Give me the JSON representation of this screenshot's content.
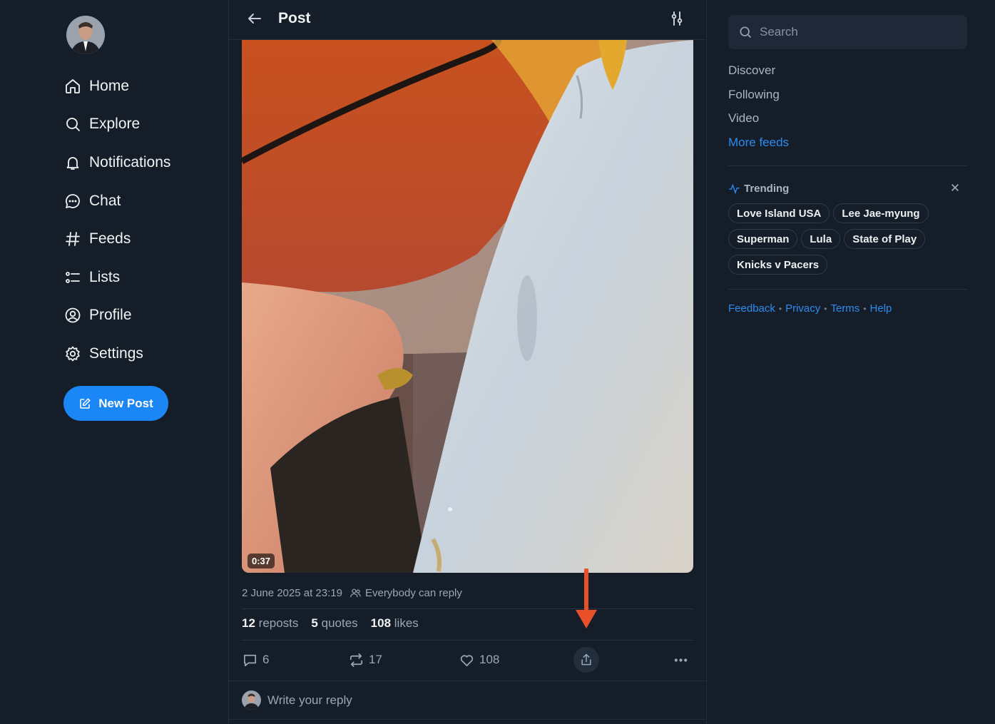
{
  "nav": {
    "items": [
      {
        "label": "Home",
        "icon": "home-icon"
      },
      {
        "label": "Explore",
        "icon": "search-icon"
      },
      {
        "label": "Notifications",
        "icon": "bell-icon"
      },
      {
        "label": "Chat",
        "icon": "chat-bubble-icon"
      },
      {
        "label": "Feeds",
        "icon": "hash-icon"
      },
      {
        "label": "Lists",
        "icon": "list-icon"
      },
      {
        "label": "Profile",
        "icon": "user-circle-icon"
      },
      {
        "label": "Settings",
        "icon": "gear-icon"
      }
    ],
    "new_post_label": "New Post"
  },
  "header": {
    "title": "Post"
  },
  "post": {
    "video_duration": "0:37",
    "timestamp": "2 June 2025 at 23:19",
    "reply_setting": "Everybody can reply",
    "stats": {
      "reposts_count": "12",
      "reposts_label": "reposts",
      "quotes_count": "5",
      "quotes_label": "quotes",
      "likes_count": "108",
      "likes_label": "likes"
    },
    "actions": {
      "replies": "6",
      "reposts": "17",
      "likes": "108"
    }
  },
  "reply": {
    "placeholder": "Write your reply"
  },
  "sidebar": {
    "search_placeholder": "Search",
    "feeds": [
      {
        "label": "Discover"
      },
      {
        "label": "Following"
      },
      {
        "label": "Video"
      }
    ],
    "more_feeds_label": "More feeds",
    "trending_title": "Trending",
    "trending": [
      "Love Island USA",
      "Lee Jae-myung",
      "Superman",
      "Lula",
      "State of Play",
      "Knicks v Pacers"
    ],
    "footer": [
      "Feedback",
      "Privacy",
      "Terms",
      "Help"
    ]
  },
  "colors": {
    "background": "#151d28",
    "accent": "#1b86f5",
    "link": "#2b8cf0",
    "annotation_arrow": "#e8502a"
  }
}
